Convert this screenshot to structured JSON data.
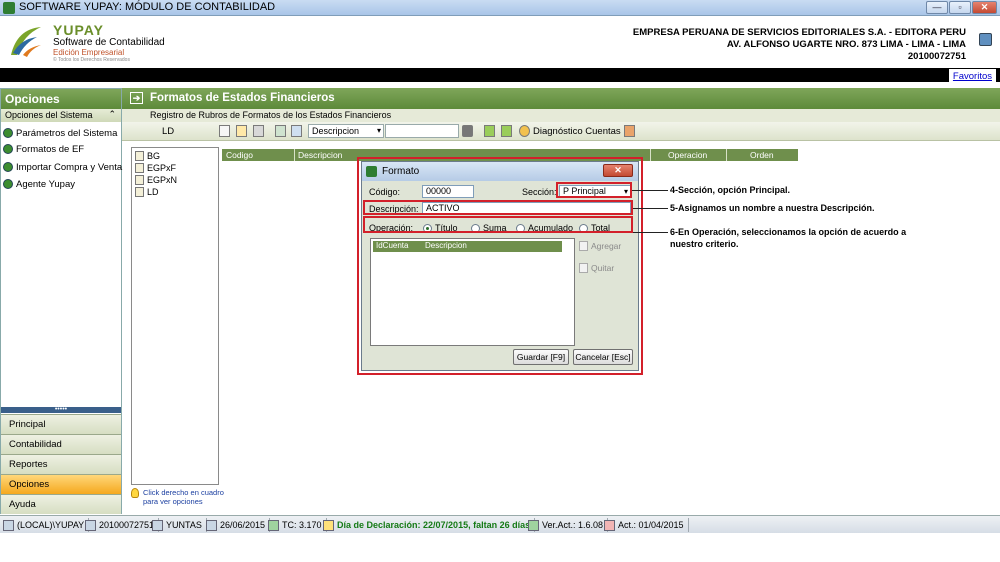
{
  "window": {
    "title": "SOFTWARE YUPAY: MÓDULO DE CONTABILIDAD",
    "minimize_glyph": "—",
    "maximize_glyph": "▫",
    "close_glyph": "✕"
  },
  "header": {
    "logo_title": "YUPAY",
    "logo_subtitle": "Software de Contabilidad",
    "logo_edition": "Edición Empresarial",
    "logo_rights": "© Todos los Derechos Reservados",
    "company_name": "EMPRESA PERUANA DE SERVICIOS EDITORIALES S.A. - EDITORA PERU",
    "company_address": "AV. ALFONSO UGARTE NRO. 873 LIMA - LIMA - LIMA",
    "company_ruc": "20100072751",
    "favorites_link": "Favoritos"
  },
  "sidebar": {
    "title": "Opciones",
    "section_label": "Opciones del Sistema",
    "collapse_glyph": "⌃",
    "items": [
      {
        "label": "Parámetros del Sistema"
      },
      {
        "label": "Formatos de EF"
      },
      {
        "label": "Importar Compra y Venta"
      },
      {
        "label": "Agente Yupay"
      }
    ],
    "grip": "•••••",
    "nav": [
      {
        "label": "Principal"
      },
      {
        "label": "Contabilidad"
      },
      {
        "label": "Reportes"
      },
      {
        "label": "Opciones"
      },
      {
        "label": "Ayuda"
      }
    ]
  },
  "main": {
    "title": "Formatos de Estados Financieros",
    "title_arrow": "➔",
    "subtitle": "Registro de Rubros de Formatos de los Estados Financieros",
    "toolbar": {
      "current_code": "LD",
      "search_field": "Descripcion",
      "search_caret": "▾",
      "diagnostic_label": "Diagnóstico Cuentas"
    },
    "tree": [
      {
        "label": "BG"
      },
      {
        "label": "EGPxF"
      },
      {
        "label": "EGPxN"
      },
      {
        "label": "LD"
      }
    ],
    "hint": "Click derecho en cuadro para ver opciones",
    "grid_columns": {
      "codigo": "Codigo",
      "descripcion": "Descripcion",
      "operacion": "Operacion",
      "orden": "Orden"
    }
  },
  "dialog": {
    "title": "Formato",
    "close_glyph": "✕",
    "codigo_label": "Código:",
    "codigo_value": "00000",
    "seccion_label": "Sección:",
    "seccion_value": "P   Principal",
    "seccion_caret": "▾",
    "descripcion_label": "Descripción:",
    "descripcion_value": "ACTIVO",
    "operacion_label": "Operación:",
    "operacion_options": [
      {
        "label": "Título",
        "selected": true
      },
      {
        "label": "Suma",
        "selected": false
      },
      {
        "label": "Acumulado",
        "selected": false
      },
      {
        "label": "Total",
        "selected": false
      }
    ],
    "grid_columns": {
      "id_cuenta": "IdCuenta",
      "descripcion": "Descripcion"
    },
    "agregar_label": "Agregar",
    "quitar_label": "Quitar",
    "save_label": "Guardar [F9]",
    "cancel_label": "Cancelar [Esc]"
  },
  "annotations": {
    "note4": "4-Sección, opción Principal.",
    "note5": "5-Asignamos un nombre a nuestra Descripción.",
    "note6_line1": "6-En Operación, seleccionamos la opción de acuerdo a",
    "note6_line2": "nuestro criterio.",
    "color": "#d3202a"
  },
  "statusbar": {
    "server": "(LOCAL)\\YUPAY",
    "ruc": "20100072751",
    "user": "YUNTAS",
    "date": "26/06/2015",
    "tc": "TC: 3.170",
    "declaracion": "Día de Declaración: 22/07/2015, faltan 26 días",
    "version": "Ver.Act.: 1.6.08",
    "act_date": "Act.: 01/04/2015"
  }
}
